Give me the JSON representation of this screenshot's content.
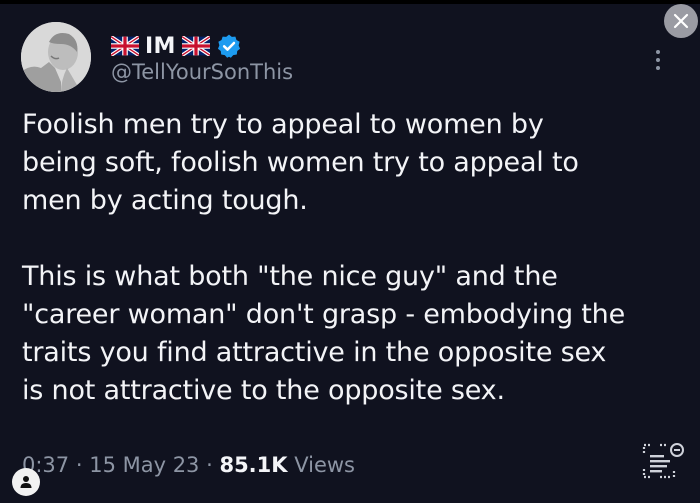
{
  "tweet": {
    "author": {
      "display_name": "IM",
      "handle": "@TellYourSonThis",
      "verified": true,
      "flag_icon": "uk-flag-icon"
    },
    "paragraphs": [
      "Foolish men try to appeal to women by\nbeing soft, foolish women try to appeal to\nmen by acting tough.",
      "This is what both \"the nice guy\" and the\n\"career woman\" don't grasp - embodying the\ntraits you find attractive in the opposite sex\nis not attractive to the opposite sex."
    ],
    "time": "0:37",
    "separator": " · ",
    "date": "15 May 23",
    "views_count": "85.1K",
    "views_label": " Views"
  },
  "colors": {
    "background": "#10121f",
    "text_primary": "#f3f4f7",
    "text_secondary": "#8d95a4",
    "verified_badge": "#1d9bf0"
  },
  "icons": {
    "close": "close-icon",
    "more": "more-vertical-icon",
    "verified": "verified-badge-icon",
    "user": "user-icon",
    "scan": "text-scan-icon"
  }
}
